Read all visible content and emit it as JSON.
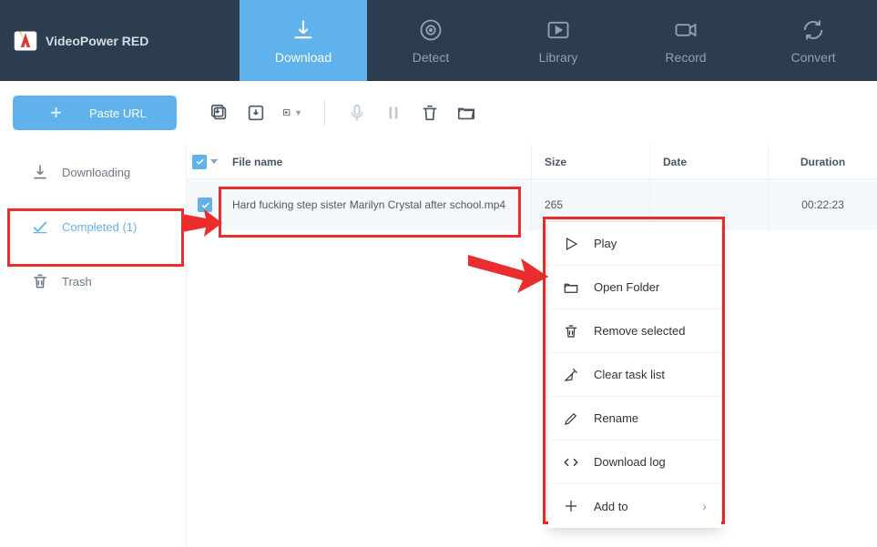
{
  "app": {
    "title": "VideoPower RED"
  },
  "nav": {
    "download": "Download",
    "detect": "Detect",
    "library": "Library",
    "record": "Record",
    "convert": "Convert"
  },
  "toolbar": {
    "paste_url": "Paste URL"
  },
  "sidebar": {
    "downloading": "Downloading",
    "completed": "Completed (1)",
    "trash": "Trash"
  },
  "table": {
    "headers": {
      "file_name": "File name",
      "size": "Size",
      "date": "Date",
      "duration": "Duration"
    },
    "rows": [
      {
        "name": "Hard fucking step sister Marilyn Crystal after school.mp4",
        "size": "265",
        "date": "",
        "duration": "00:22:23"
      }
    ]
  },
  "context_menu": {
    "play": "Play",
    "open_folder": "Open Folder",
    "remove_selected": "Remove selected",
    "clear_task_list": "Clear task list",
    "rename": "Rename",
    "download_log": "Download log",
    "add_to": "Add to"
  }
}
